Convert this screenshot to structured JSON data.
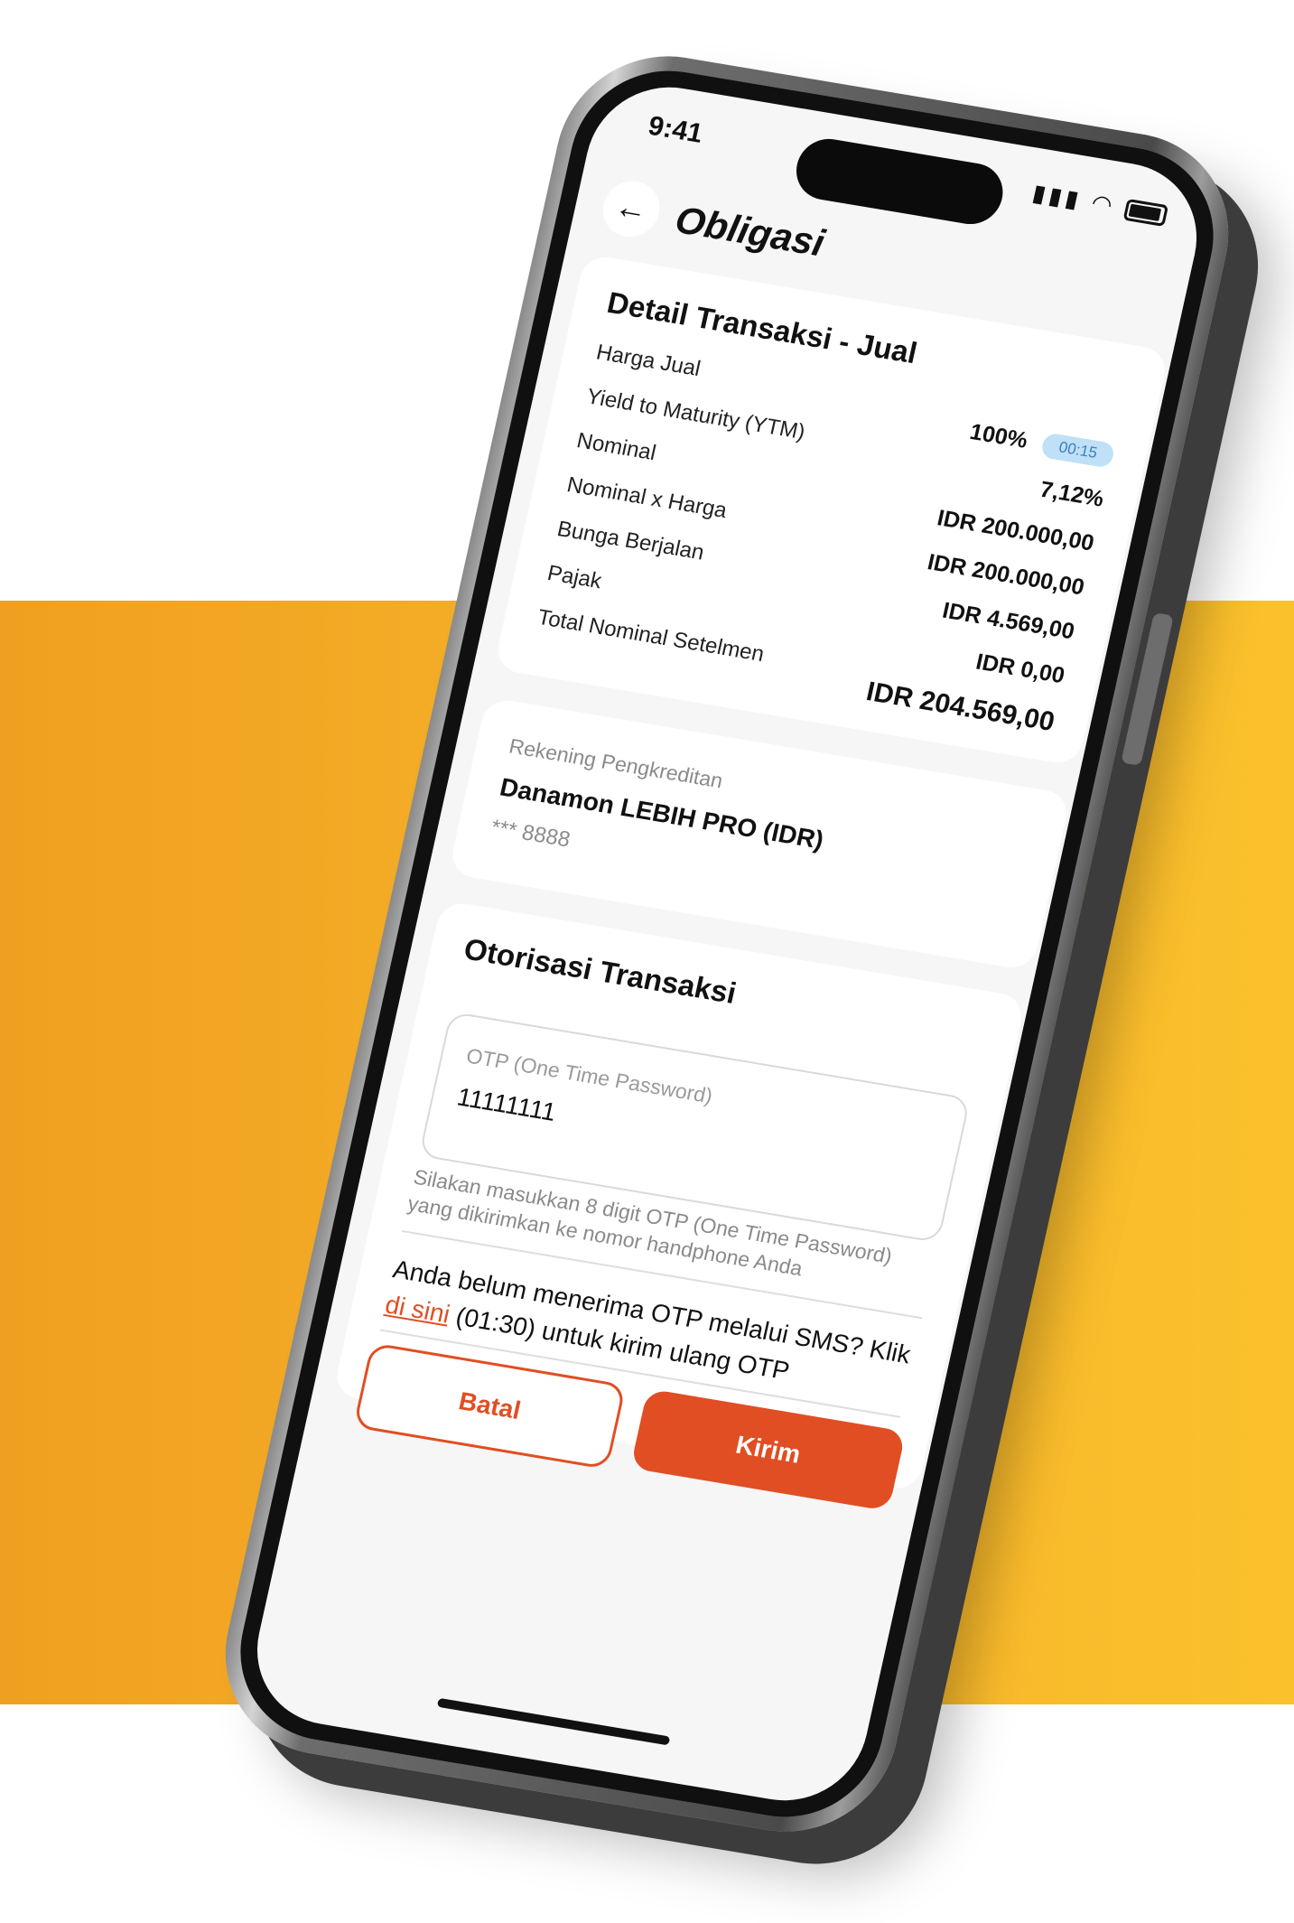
{
  "status_bar": {
    "time": "9:41",
    "signal_icon": "signal-icon",
    "wifi_icon": "wifi-icon",
    "battery_icon": "battery-icon"
  },
  "header": {
    "back_icon": "arrow-left-icon",
    "title": "Obligasi"
  },
  "detail": {
    "title": "Detail Transaksi - Jual",
    "rows": [
      {
        "label": "Harga Jual",
        "value": "100%"
      },
      {
        "label": "Yield to Maturity (YTM)",
        "value": "7,12%"
      },
      {
        "label": "Nominal",
        "value": "IDR 200.000,00"
      },
      {
        "label": "Nominal x Harga",
        "value": "IDR 200.000,00"
      },
      {
        "label": "Bunga Berjalan",
        "value": "IDR 4.569,00"
      },
      {
        "label": "Pajak",
        "value": "IDR 0,00"
      },
      {
        "label": "Total Nominal Setelmen",
        "value": "IDR 204.569,00"
      }
    ],
    "timer": "00:15"
  },
  "account": {
    "label": "Rekening Pengkreditan",
    "name": "Danamon LEBIH PRO (IDR)",
    "number": "*** 8888"
  },
  "authorization": {
    "title": "Otorisasi Transaksi",
    "otp_placeholder": "OTP (One Time Password)",
    "otp_value": "11111111",
    "help": "Silakan masukkan 8 digit OTP (One Time Password) yang dikirimkan ke nomor handphone Anda",
    "resend_prefix": "Anda belum menerima OTP melalui SMS? Klik ",
    "resend_link": "di sini",
    "resend_suffix": " (01:30) untuk kirim ulang OTP"
  },
  "buttons": {
    "cancel": "Batal",
    "submit": "Kirim"
  },
  "colors": {
    "accent": "#e14e24",
    "band": "#f6b32a",
    "badge_bg": "#bfe0f7"
  }
}
